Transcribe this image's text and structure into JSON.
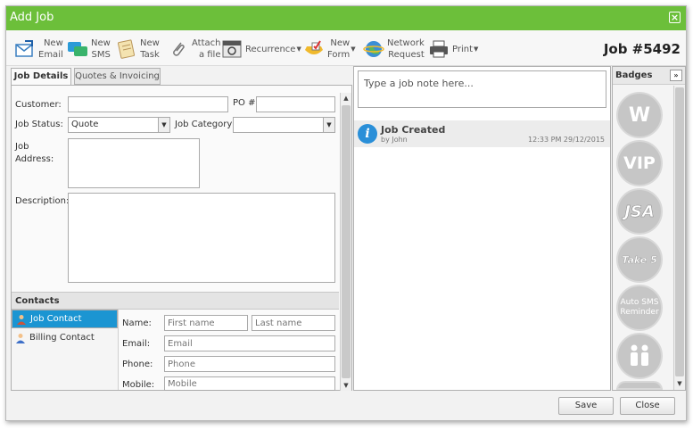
{
  "window": {
    "title": "Add Job",
    "job_number": "Job #5492"
  },
  "toolbar": {
    "new_email": [
      "New",
      "Email"
    ],
    "new_sms": [
      "New",
      "SMS"
    ],
    "new_task": [
      "New",
      "Task"
    ],
    "attach": [
      "Attach",
      "a file"
    ],
    "recurrence": "Recurrence",
    "new_form": [
      "New",
      "Form"
    ],
    "network_request": [
      "Network",
      "Request"
    ],
    "print": "Print"
  },
  "tabs": {
    "job_details": "Job Details",
    "quotes": "Quotes & Invoicing"
  },
  "form": {
    "customer_label": "Customer:",
    "customer_value": "",
    "po_label": "PO #",
    "po_value": "",
    "job_status_label": "Job Status:",
    "job_status_value": "Quote",
    "job_category_label": "Job Category",
    "job_category_value": "",
    "job_address_label": [
      "Job",
      "Address:"
    ],
    "description_label": "Description:"
  },
  "contacts": {
    "header": "Contacts",
    "items": [
      "Job Contact",
      "Billing Contact"
    ],
    "name_label": "Name:",
    "first_name_placeholder": "First name",
    "last_name_placeholder": "Last name",
    "email_label": "Email:",
    "email_placeholder": "Email",
    "phone_label": "Phone:",
    "phone_placeholder": "Phone",
    "mobile_label": "Mobile:",
    "mobile_placeholder": "Mobile"
  },
  "notes": {
    "placeholder": "Type a job note here...",
    "event_title": "Job Created",
    "event_by": "by John",
    "event_time": "12:33 PM 29/12/2015"
  },
  "badges": {
    "header": "Badges",
    "items": [
      "W",
      "VIP",
      "JSA",
      "Take 5",
      "Auto SMS Reminder",
      ""
    ]
  },
  "footer": {
    "save": "Save",
    "close": "Close"
  },
  "colors": {
    "titlebar": "#6cbf3a",
    "selected": "#1b95d2",
    "badge": "#c6c6c6"
  }
}
